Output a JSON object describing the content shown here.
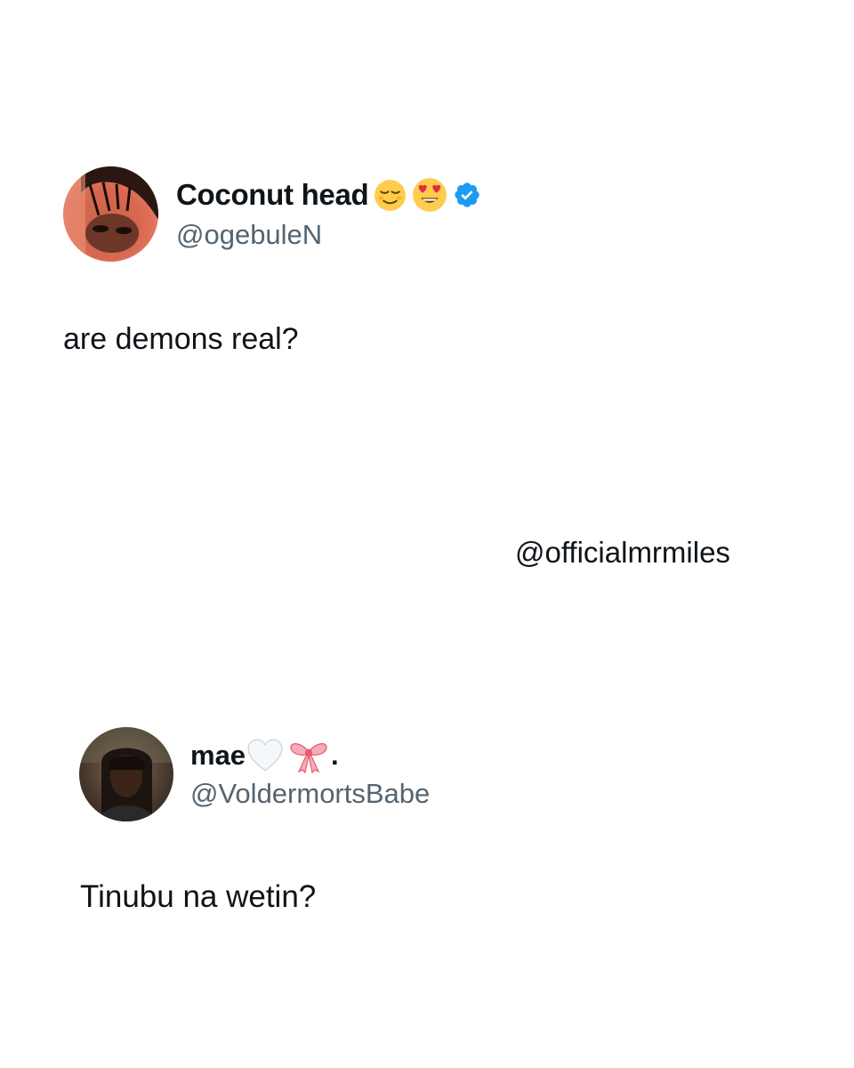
{
  "tweets": [
    {
      "display_name": "Coconut head",
      "name_emojis": [
        "relieved-face-emoji",
        "heart-eyes-emoji"
      ],
      "verified": true,
      "handle": "@ogebuleN",
      "text": "are demons real?"
    },
    {
      "display_name": "mae",
      "name_emojis": [
        "white-heart-emoji",
        "pink-ribbon-emoji"
      ],
      "name_suffix": ".",
      "verified": false,
      "handle": "@VoldermortsBabe",
      "text": "Tinubu na wetin?"
    }
  ],
  "watermark": "@officialmrmiles",
  "colors": {
    "text_primary": "#0f1419",
    "text_secondary": "#536471",
    "verified_blue": "#1d9bf0",
    "background": "#ffffff"
  }
}
